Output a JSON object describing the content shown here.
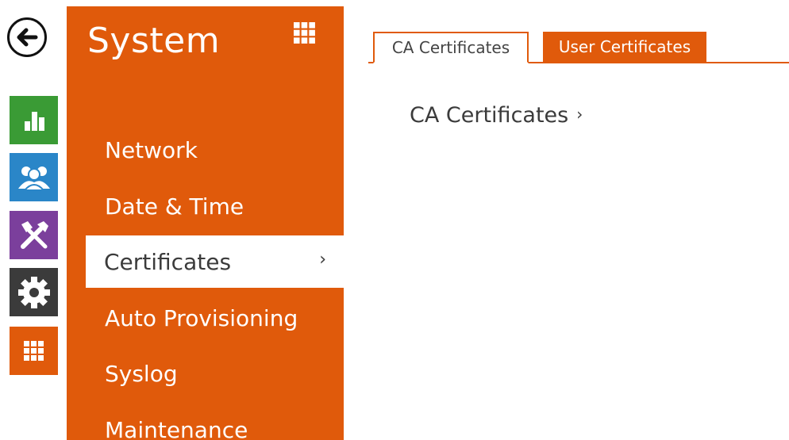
{
  "icons": {
    "back": "back-arrow-icon",
    "status": "bar-chart-icon",
    "users": "users-icon",
    "services": "tools-icon",
    "hardware": "gear-icon",
    "system": "grid-icon"
  },
  "colors": {
    "accent": "#e05a0b",
    "status": "#3a9b35",
    "users": "#2a86c8",
    "services": "#7b3f9c",
    "hardware": "#3b3b3b"
  },
  "menu": {
    "title": "System",
    "items": [
      {
        "label": "Network"
      },
      {
        "label": "Date & Time"
      },
      {
        "label": "Certificates"
      },
      {
        "label": "Auto Provisioning"
      },
      {
        "label": "Syslog"
      },
      {
        "label": "Maintenance"
      }
    ],
    "active_chevron": "›"
  },
  "tabs": [
    {
      "label": "CA Certificates",
      "active": true
    },
    {
      "label": "User Certificates",
      "active": false
    }
  ],
  "content": {
    "section_title": "CA Certificates",
    "section_chevron": "›"
  }
}
